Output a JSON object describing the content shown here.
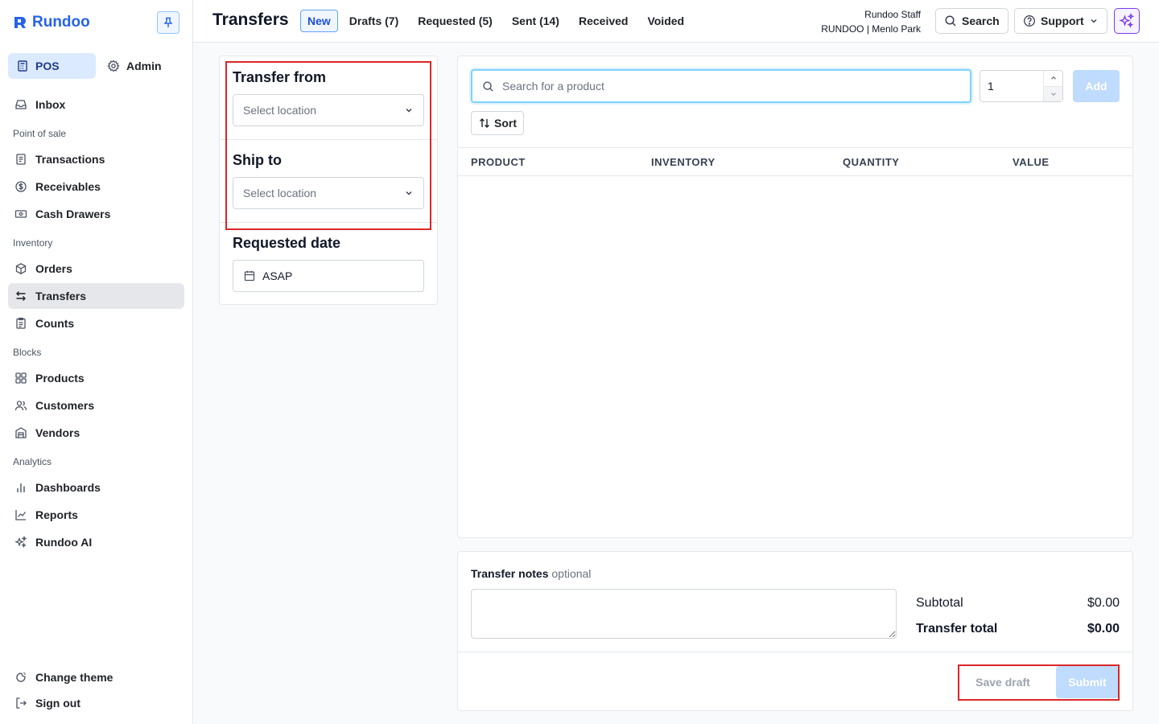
{
  "brand": {
    "name": "Rundoo"
  },
  "sidebar": {
    "modes": [
      {
        "label": "POS",
        "active": true
      },
      {
        "label": "Admin",
        "active": false
      }
    ],
    "inbox": "Inbox",
    "sections": {
      "pos": "Point of sale",
      "inventory": "Inventory",
      "blocks": "Blocks",
      "analytics": "Analytics"
    },
    "items": {
      "transactions": "Transactions",
      "receivables": "Receivables",
      "cash_drawers": "Cash Drawers",
      "orders": "Orders",
      "transfers": "Transfers",
      "counts": "Counts",
      "products": "Products",
      "customers": "Customers",
      "vendors": "Vendors",
      "dashboards": "Dashboards",
      "reports": "Reports",
      "rundoo_ai": "Rundoo AI"
    },
    "footer": {
      "change_theme": "Change theme",
      "sign_out": "Sign out"
    },
    "active_item": "transfers"
  },
  "header": {
    "title": "Transfers",
    "tabs": [
      {
        "label": "New",
        "active": true
      },
      {
        "label": "Drafts (7)",
        "active": false
      },
      {
        "label": "Requested (5)",
        "active": false
      },
      {
        "label": "Sent (14)",
        "active": false
      },
      {
        "label": "Received",
        "active": false
      },
      {
        "label": "Voided",
        "active": false
      }
    ],
    "user_name": "Rundoo Staff",
    "user_location": "RUNDOO | Menlo Park",
    "search_label": "Search",
    "support_label": "Support"
  },
  "transfer_form": {
    "from_label": "Transfer from",
    "from_placeholder": "Select location",
    "ship_to_label": "Ship to",
    "ship_to_placeholder": "Select location",
    "requested_date_label": "Requested date",
    "requested_date_value": "ASAP"
  },
  "products": {
    "search_placeholder": "Search for a product",
    "quantity_value": "1",
    "add_label": "Add",
    "sort_label": "Sort",
    "columns": [
      "PRODUCT",
      "INVENTORY",
      "QUANTITY",
      "VALUE"
    ],
    "rows": []
  },
  "summary": {
    "notes_label": "Transfer notes",
    "notes_optional": "optional",
    "notes_value": "",
    "subtotal_label": "Subtotal",
    "subtotal_value": "$0.00",
    "total_label": "Transfer total",
    "total_value": "$0.00",
    "save_draft_label": "Save draft",
    "submit_label": "Submit"
  },
  "colors": {
    "brand": "#2563eb",
    "accent_ai": "#7c3aed",
    "highlight_box": "#dc2626",
    "disabled_button": "#bfdbfe"
  }
}
